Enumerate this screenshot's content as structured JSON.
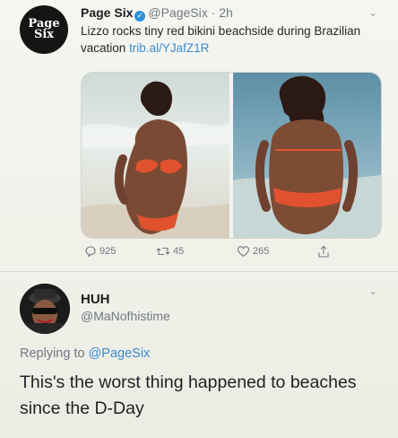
{
  "tweet1": {
    "avatar_text_line1": "Page",
    "avatar_text_line2": "Six",
    "display_name": "Page Six",
    "handle": "@PageSix",
    "separator": "·",
    "time": "2h",
    "text": "Lizzo rocks tiny red bikini beachside during Brazilian vacation",
    "link": "trib.al/YJafZ1R",
    "actions": {
      "reply_count": "925",
      "retweet_count": "45",
      "like_count": "265"
    },
    "icons": {
      "verified": "verified-badge-icon",
      "menu": "chevron-down-icon",
      "reply": "reply-icon",
      "retweet": "retweet-icon",
      "like": "heart-icon",
      "share": "share-icon"
    }
  },
  "tweet2": {
    "display_name": "HUH",
    "handle": "@MaNofhistime",
    "replying_prefix": "Replying to",
    "replying_to": "@PageSix",
    "text": "This's the worst thing happened to beaches since the D-Day"
  },
  "colors": {
    "link": "#3a8bd1",
    "verified": "#2c91d8",
    "muted": "#6f7782",
    "bikini": "#e0522e"
  }
}
